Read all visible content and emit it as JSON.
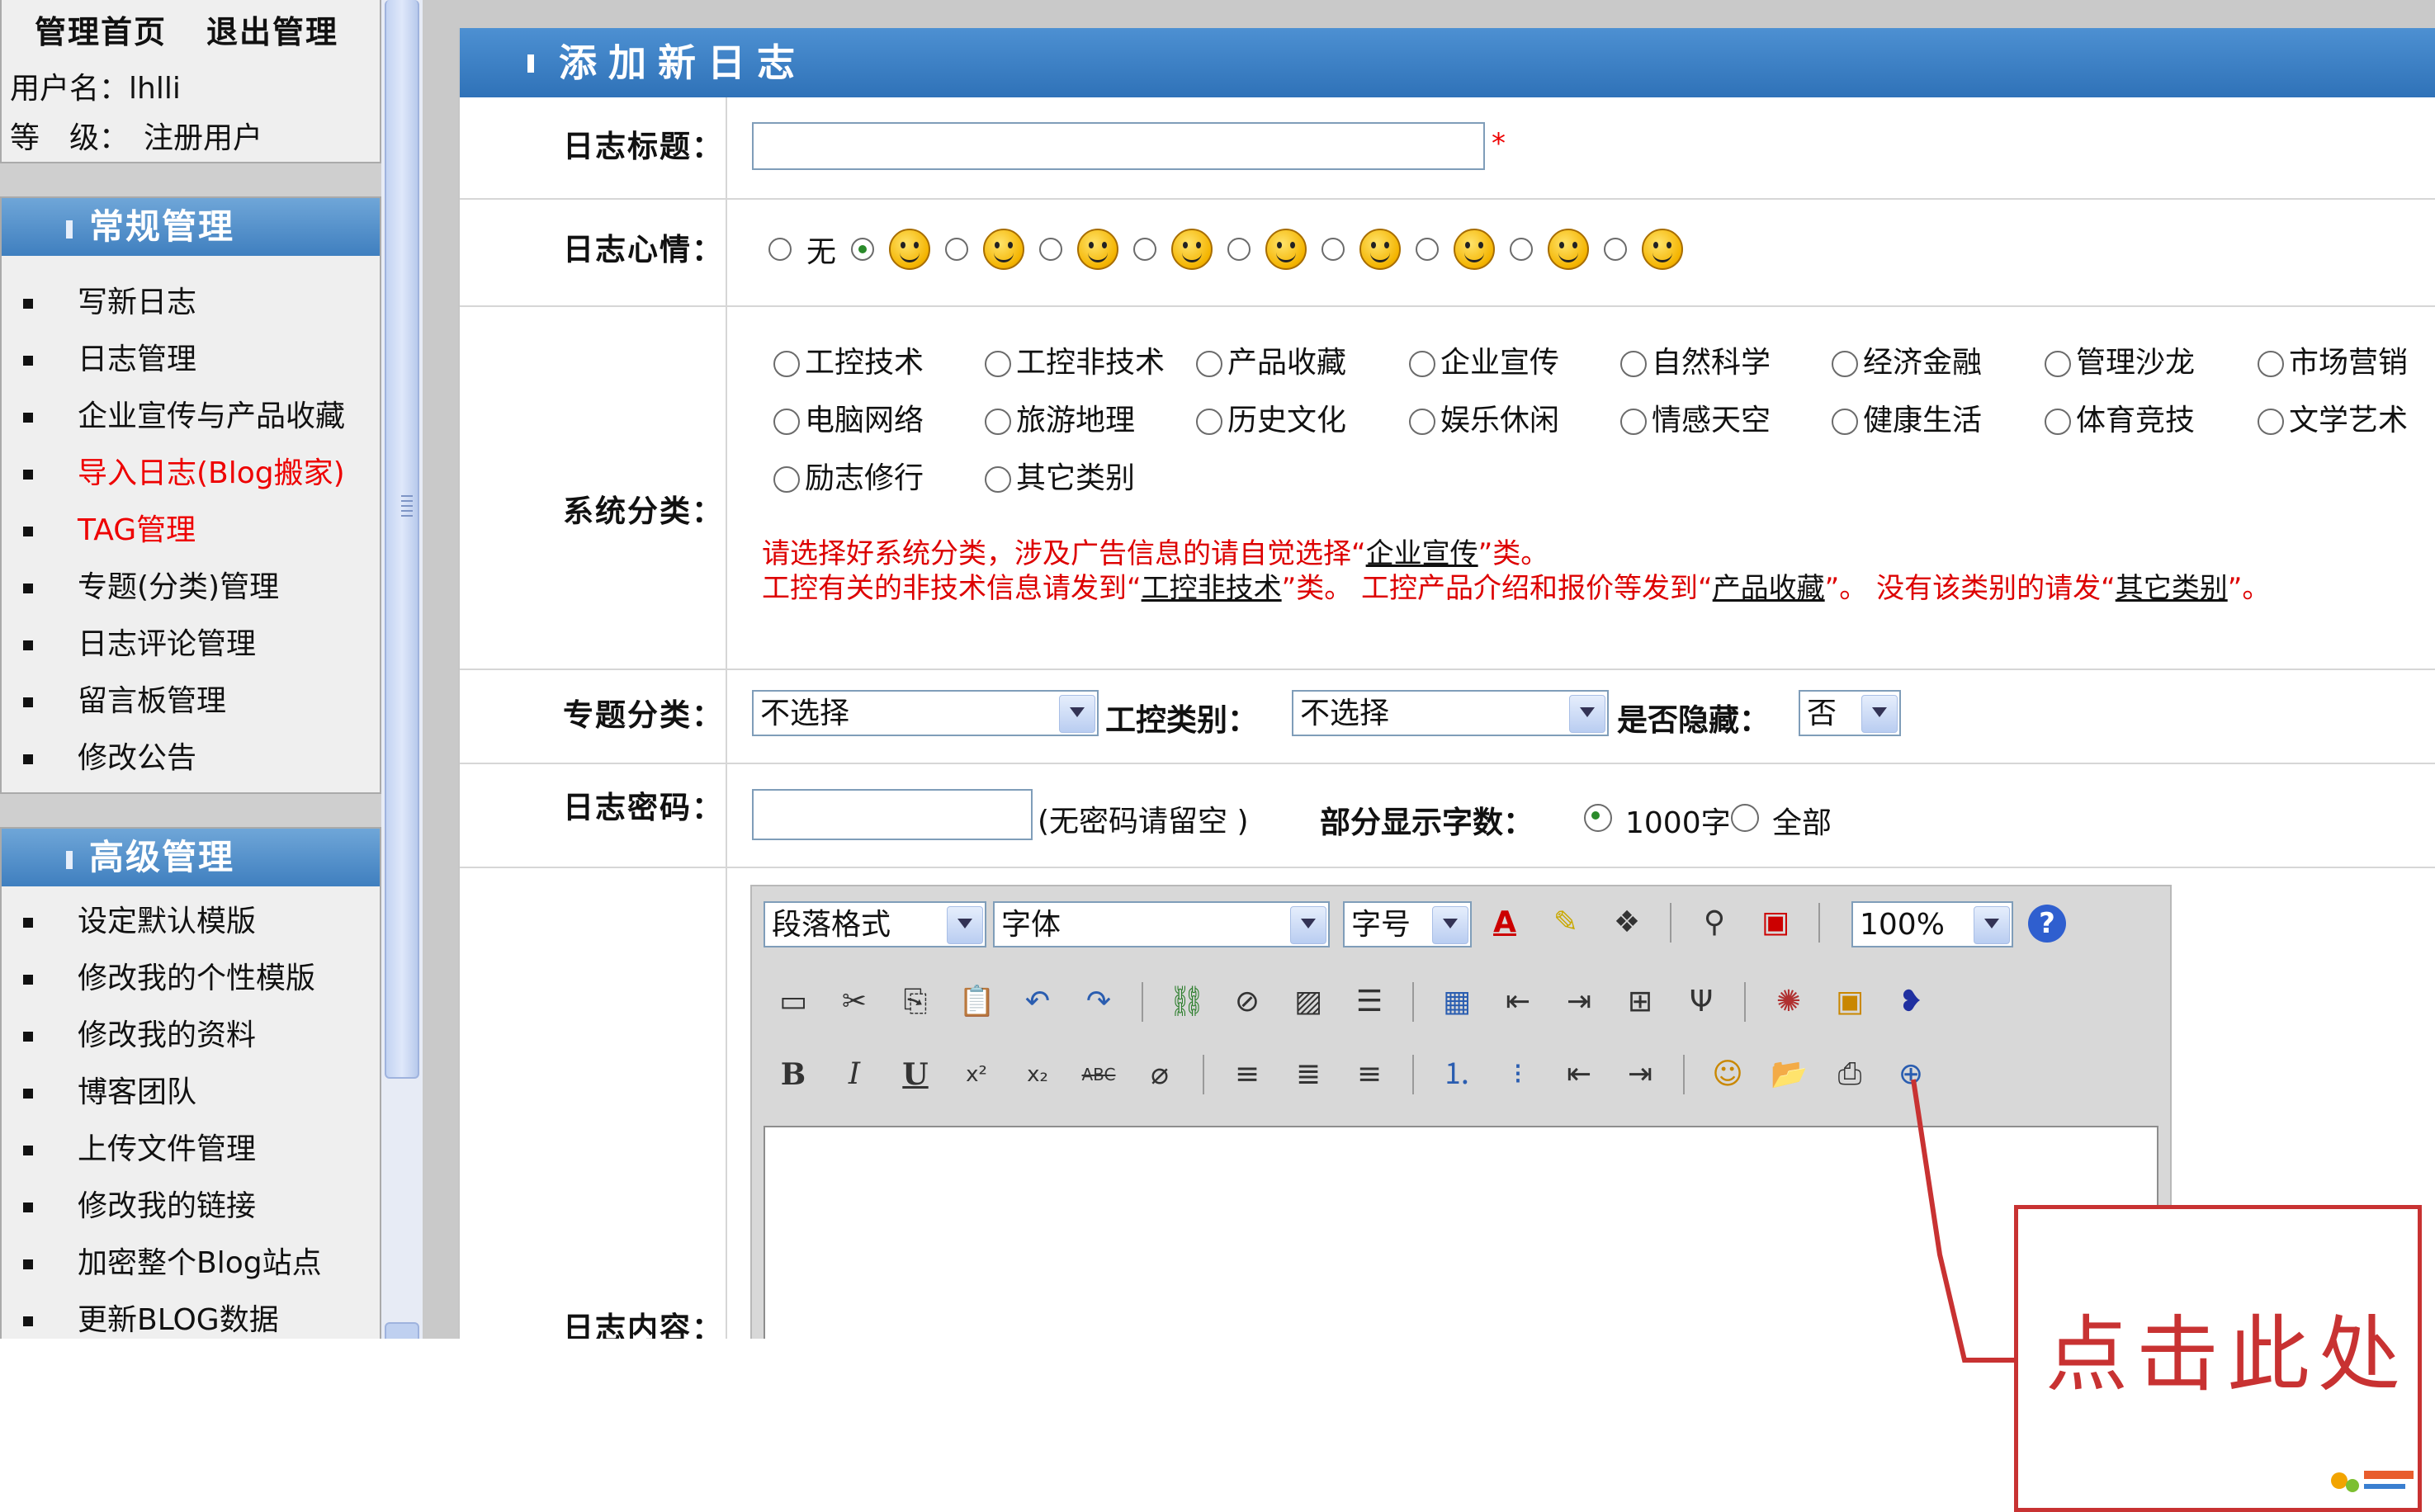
{
  "sidebar": {
    "links": [
      "管理首页",
      "退出管理"
    ],
    "username": "用户名：lhlli",
    "level": "等　级：　注册用户",
    "general": {
      "title": "常规管理",
      "items": [
        "写新日志",
        "日志管理",
        "企业宣传与产品收藏",
        "导入日志(Blog搬家)",
        "TAG管理",
        "专题(分类)管理",
        "日志评论管理",
        "留言板管理",
        "修改公告"
      ]
    },
    "advanced": {
      "title": "高级管理",
      "items": [
        "设定默认模版",
        "修改我的个性模版",
        "修改我的资料",
        "博客团队",
        "上传文件管理",
        "修改我的链接",
        "加密整个Blog站点",
        "更新BLOG数据"
      ]
    }
  },
  "form": {
    "title": "添加新日志",
    "title_label": "日志标题：",
    "required_mark": "*",
    "mood_label": "日志心情：",
    "mood_none": "无",
    "category_label": "系统分类：",
    "categories": [
      "工控技术",
      "工控非技术",
      "产品收藏",
      "企业宣传",
      "自然科学",
      "经济金融",
      "管理沙龙",
      "市场营销",
      "电脑网络",
      "旅游地理",
      "历史文化",
      "娱乐休闲",
      "情感天空",
      "健康生活",
      "体育竞技",
      "文学艺术",
      "励志修行",
      "其它类别"
    ],
    "notice_1": "请选择好系统分类，涉及广告信息的请自觉选择“",
    "notice_1_link": "企业宣传",
    "notice_1_end": "”类。",
    "notice_2a": "工控有关的非技术信息请发到“",
    "notice_2a_link": "工控非技术",
    "notice_2b": "”类。 工控产品介绍和报价等发到“",
    "notice_2b_link": "产品收藏",
    "notice_2c": "”。 没有该类别的请发“",
    "notice_2c_link": "其它类别",
    "notice_2d": "”。",
    "topic_label": "专题分类：",
    "topic_value": "不选择",
    "industry_label": "工控类别：",
    "industry_value": "不选择",
    "hidden_label": "是否隐藏：",
    "hidden_value": "否",
    "password_label": "日志密码：",
    "password_hint": "(无密码请留空 )",
    "partial_label": "部分显示字数：",
    "partial_option1": "1000字",
    "partial_option2": "全部",
    "content_label": "日志内容："
  },
  "editor": {
    "format_select": "段落格式",
    "font_select": "字体",
    "size_select": "字号",
    "zoom_select": "100%"
  },
  "annotation": {
    "text": "点击此处",
    "color": "#c83232"
  }
}
